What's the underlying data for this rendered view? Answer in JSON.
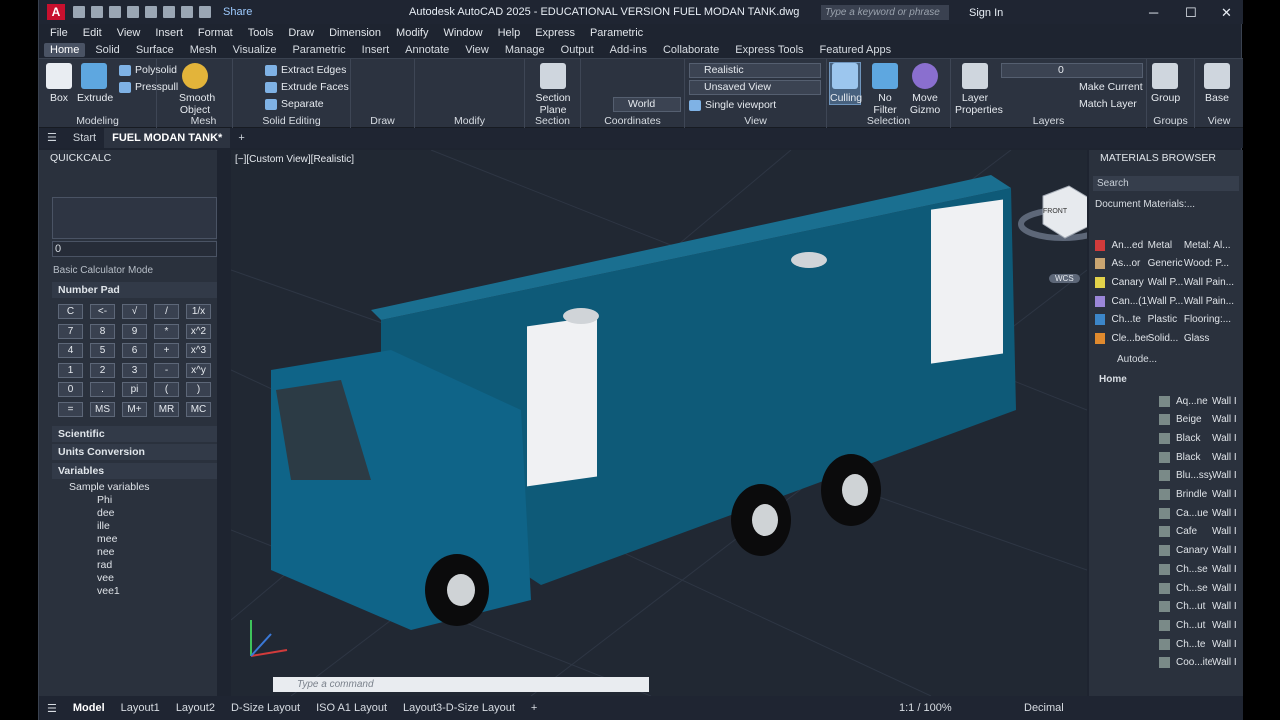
{
  "app": {
    "title": "Autodesk AutoCAD 2025 - EDUCATIONAL VERSION    FUEL MODAN TANK.dwg",
    "share": "Share",
    "search_placeholder": "Type a keyword or phrase",
    "signin": "Sign In",
    "logo": "A"
  },
  "menus": [
    "File",
    "Edit",
    "View",
    "Insert",
    "Format",
    "Tools",
    "Draw",
    "Dimension",
    "Modify",
    "Window",
    "Help",
    "Express",
    "Parametric"
  ],
  "ribbon_tabs": [
    "Home",
    "Solid",
    "Surface",
    "Mesh",
    "Visualize",
    "Parametric",
    "Insert",
    "Annotate",
    "View",
    "Manage",
    "Output",
    "Add-ins",
    "Collaborate",
    "Express Tools",
    "Featured Apps"
  ],
  "ribbon": {
    "box": "Box",
    "extrude": "Extrude",
    "polysolid": "Polysolid",
    "presspull": "Presspull",
    "smooth": "Smooth Object",
    "extract_edges": "Extract Edges",
    "extrude_faces": "Extrude Faces",
    "separate": "Separate",
    "section_plane": "Section Plane",
    "world": "World",
    "realistic": "Realistic",
    "unsaved_view": "Unsaved View",
    "single_viewport": "Single viewport",
    "culling": "Culling",
    "no_filter": "No Filter",
    "move_gizmo": "Move Gizmo",
    "layer_props": "Layer Properties",
    "layer_value": "0",
    "make_current": "Make Current",
    "match_layer": "Match Layer",
    "group": "Group",
    "base": "Base",
    "groups": {
      "modeling": "Modeling",
      "mesh": "Mesh",
      "solid_editing": "Solid Editing",
      "draw": "Draw",
      "modify": "Modify",
      "section": "Section",
      "coordinates": "Coordinates",
      "view": "View",
      "selection": "Selection",
      "layers": "Layers",
      "groups": "Groups",
      "view2": "View"
    }
  },
  "doc_tabs": {
    "start": "Start",
    "file": "FUEL MODAN TANK*"
  },
  "quickcalc": {
    "title": "QUICKCALC",
    "value": "0",
    "mode": "Basic Calculator Mode",
    "number_pad": "Number Pad",
    "keys": [
      "C",
      "<-",
      "√",
      "/",
      "1/x",
      "7",
      "8",
      "9",
      "*",
      "x^2",
      "4",
      "5",
      "6",
      "+",
      "x^3",
      "1",
      "2",
      "3",
      "-",
      "x^y",
      "0",
      ".",
      "pi",
      "(",
      ")",
      "=",
      "MS",
      "M+",
      "MR",
      "MC"
    ],
    "scientific": "Scientific",
    "units": "Units Conversion",
    "variables": "Variables",
    "sample": "Sample variables",
    "vars": [
      "Phi",
      "dee",
      "ille",
      "mee",
      "nee",
      "rad",
      "vee",
      "vee1"
    ]
  },
  "viewport": {
    "label": "[−][Custom View][Realistic]",
    "cube_top": "FRONT",
    "cube_left": "LEFT",
    "wcs": "WCS"
  },
  "materials": {
    "title": "MATERIALS BROWSER",
    "search": "Search",
    "doc_materials": "Document Materials:...",
    "headers": [
      "Na",
      "Type",
      "Category"
    ],
    "rows": [
      [
        "An...ed",
        "Metal",
        "Metal: Al..."
      ],
      [
        "As...or",
        "Generic",
        "Wood: P..."
      ],
      [
        "Canary",
        "Wall P...",
        "Wall Pain..."
      ],
      [
        "Can...(1)",
        "Wall P...",
        "Wall Pain..."
      ],
      [
        "Ch...te",
        "Plastic",
        "Flooring:..."
      ],
      [
        "Cle...ber",
        "Solid...",
        "Glass"
      ]
    ],
    "lib": "Autode...",
    "home": "Home",
    "lib_headers": [
      "Na",
      "Type"
    ],
    "lib_rows": [
      "Aq...ne",
      "Beige",
      "Black",
      "Black",
      "Blu...ssy",
      "Brindle",
      "Ca...ue",
      "Cafe",
      "Canary",
      "Ch...se",
      "Ch...se",
      "Ch...ut",
      "Ch...ut",
      "Ch...te",
      "Coo...ite"
    ],
    "lib_type": "Wall I"
  },
  "command": {
    "placeholder": "Type a command"
  },
  "status": {
    "model": "Model",
    "layouts": [
      "Layout1",
      "Layout2",
      "D-Size Layout",
      "ISO A1 Layout",
      "Layout3-D-Size Layout"
    ],
    "scale": "1:1 / 100%",
    "units": "Decimal"
  },
  "colors": {
    "truck": "#0e5a78",
    "accent": "#3c86c9"
  }
}
